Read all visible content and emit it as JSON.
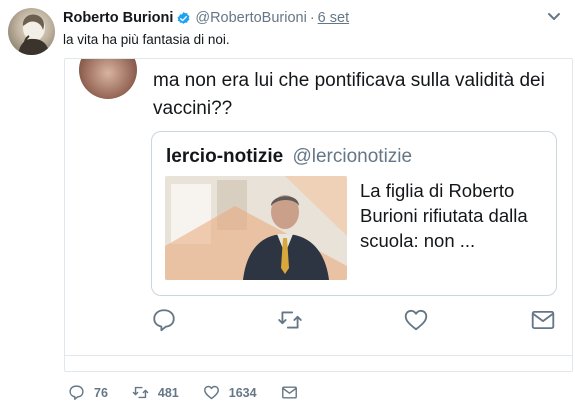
{
  "tweet": {
    "author_name": "Roberto Burioni",
    "handle": "@RobertoBurioni",
    "separator": "·",
    "date": "6 set",
    "text": "la vita ha più fantasia di noi."
  },
  "embedded": {
    "text": "ma non era lui che pontificava sulla validità dei vaccini??",
    "quote": {
      "name": "lercio-notizie",
      "handle": "@lercionotizie",
      "body": "La figlia di Roberto Burioni rifiutata dalla scuola: non ..."
    },
    "icons": [
      "reply-icon",
      "retweet-icon",
      "like-icon",
      "message-icon"
    ]
  },
  "actions": {
    "replies": "76",
    "retweets": "481",
    "likes": "1634"
  },
  "colors": {
    "text": "#14171a",
    "muted": "#657786",
    "verified": "#1da1f2",
    "border": "#e1e8ed"
  }
}
